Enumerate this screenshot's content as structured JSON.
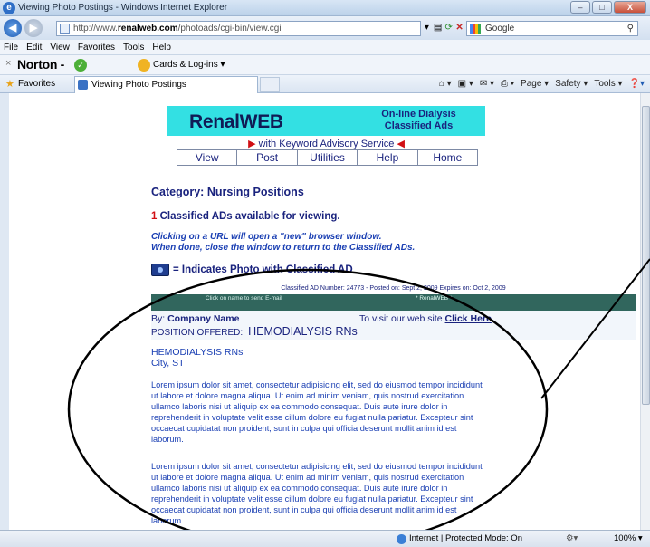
{
  "window": {
    "title": "Viewing Photo Postings - Windows Internet Explorer",
    "buttons": {
      "min": "–",
      "max": "□",
      "close": "X"
    }
  },
  "address": {
    "url_prefix": "http://www.",
    "url_domain": "renalweb.com",
    "url_path": "/photoads/cgi-bin/view.cgi",
    "search_placeholder": "Google"
  },
  "menu": [
    "File",
    "Edit",
    "View",
    "Favorites",
    "Tools",
    "Help"
  ],
  "norton": {
    "close": "×",
    "brand": "Norton",
    "brand_suffix": "-",
    "cards_label": "Cards & Log-ins ▾"
  },
  "favorites_bar": {
    "favorites_label": "Favorites",
    "tab_title": "Viewing Photo Postings",
    "commands": [
      "Page ▾",
      "Safety ▾",
      "Tools ▾"
    ]
  },
  "page": {
    "logo": "RenalWEB",
    "tagline_1": "On-line Dialysis",
    "tagline_2": "Classified Ads",
    "advisory": "with Keyword Advisory Service",
    "nav": [
      "View",
      "Post",
      "Utilities",
      "Help",
      "Home"
    ],
    "category": "Category:  Nursing Positions",
    "available_count": "1",
    "available_text": " Classified ADs available for viewing.",
    "clicking_1": "Clicking on a URL will open a \"new\" browser window.",
    "clicking_2": "When done, close the window to return to the Classified ADs.",
    "photo_indicator": "= Indicates Photo with Classified AD"
  },
  "ad": {
    "number_line": "Classified AD Number: 24773 - Posted on: Sept 2, 2009   Expires on: Oct 2, 2009",
    "email_hint": "Click on name to send E-mail",
    "site_tag": "* RenalWEB *",
    "by_label": "By: ",
    "company": "Company Name",
    "visit_text": "To visit our web site ",
    "visit_link": "Click Here",
    "position_label": "POSITION OFFERED:",
    "position": "HEMODIALYSIS RNs",
    "job_title": "HEMODIALYSIS RNs",
    "location": "City, ST",
    "paragraph_1": "Lorem ipsum dolor sit amet, consectetur adipisicing elit, sed do eiusmod tempor incididunt ut labore et dolore magna aliqua. Ut enim ad minim veniam, quis nostrud exercitation ullamco laboris nisi ut aliquip ex ea commodo consequat. Duis aute irure dolor in reprehenderit in voluptate velit esse cillum dolore eu fugiat nulla pariatur. Excepteur sint occaecat cupidatat non proident, sunt in culpa qui officia deserunt mollit anim id est laborum.",
    "paragraph_2": "Lorem ipsum dolor sit amet, consectetur adipisicing elit, sed do eiusmod tempor incididunt ut labore et dolore magna aliqua. Ut enim ad minim veniam, quis nostrud exercitation ullamco laboris nisi ut aliquip ex ea commodo consequat. Duis aute irure dolor in reprehenderit in voluptate velit esse cillum dolore eu fugiat nulla pariatur. Excepteur sint occaecat cupidatat non proident, sunt in culpa qui officia deserunt mollit anim id est laborum."
  },
  "status": {
    "zone": "Internet | Protected Mode: On",
    "zoom": "100% ▾"
  },
  "colors": {
    "banner": "#33e0e3",
    "navy": "#1a237e",
    "ad_bar": "#31665d",
    "accent_red": "#d10f14"
  }
}
